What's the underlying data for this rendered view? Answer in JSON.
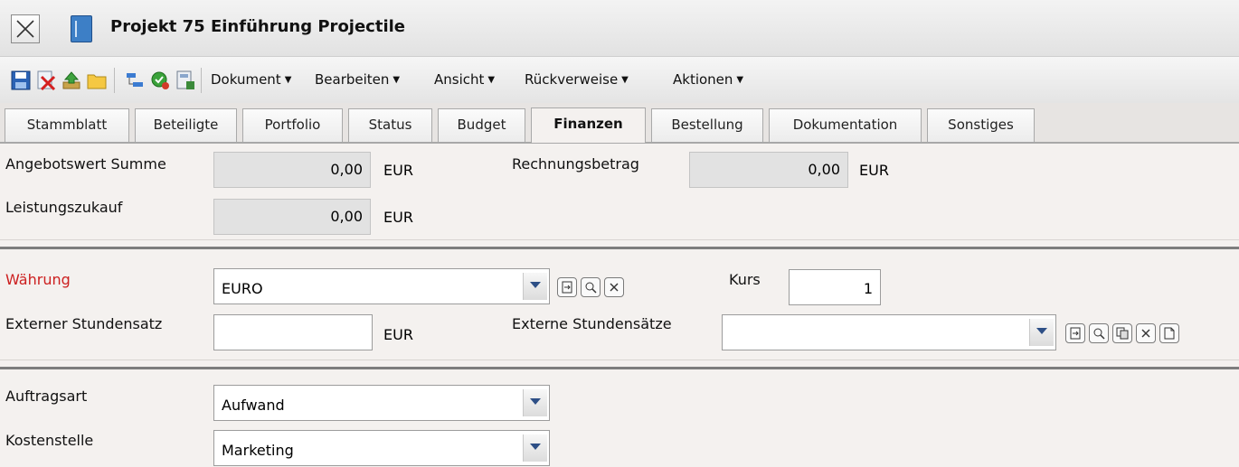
{
  "title": "Projekt 75 Einführung Projectile",
  "toolbar": {
    "menus": [
      "Dokument",
      "Bearbeiten",
      "Ansicht",
      "Rückverweise",
      "Aktionen"
    ],
    "caret": "▼"
  },
  "tabs": [
    "Stammblatt",
    "Beteiligte",
    "Portfolio",
    "Status",
    "Budget",
    "Finanzen",
    "Bestellung",
    "Dokumentation",
    "Sonstiges"
  ],
  "active_tab": "Finanzen",
  "form": {
    "angebotswert": {
      "label": "Angebotswert Summe",
      "value": "0,00",
      "unit": "EUR"
    },
    "rechnungsbetrag": {
      "label": "Rechnungsbetrag",
      "value": "0,00",
      "unit": "EUR"
    },
    "leistungszukauf": {
      "label": "Leistungszukauf",
      "value": "0,00",
      "unit": "EUR"
    },
    "waehrung": {
      "label": "Währung",
      "value": "EURO"
    },
    "kurs": {
      "label": "Kurs",
      "value": "1"
    },
    "ext_stundensatz": {
      "label": "Externer Stundensatz",
      "value": "",
      "unit": "EUR"
    },
    "ext_stundensaetze": {
      "label": "Externe Stundensätze",
      "value": ""
    },
    "auftragsart": {
      "label": "Auftragsart",
      "value": "Aufwand"
    },
    "kostenstelle": {
      "label": "Kostenstelle",
      "value": "Marketing"
    }
  },
  "colors": {
    "required_label": "#cc1f1f",
    "accent": "#3d7fc6"
  }
}
